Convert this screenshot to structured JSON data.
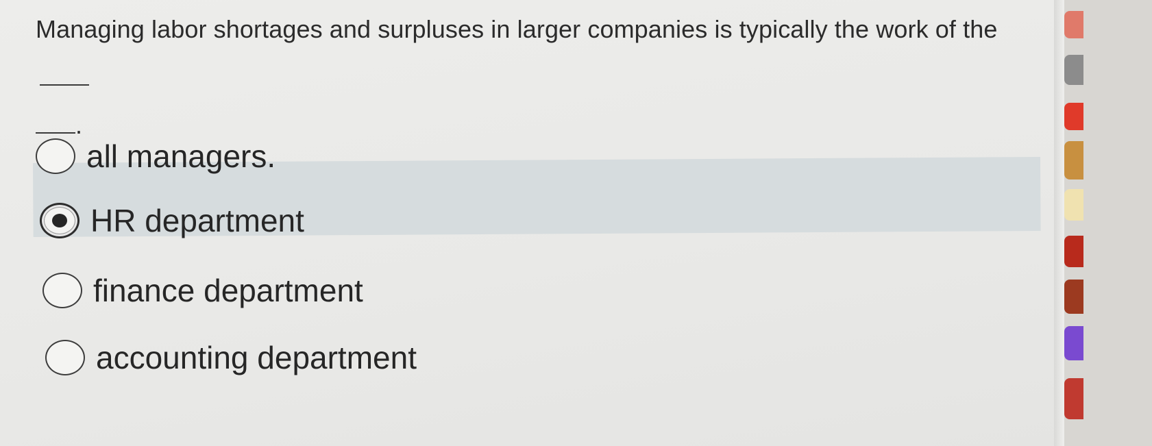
{
  "question": {
    "text": "Managing labor shortages and surpluses in larger companies is typically the work of the",
    "end_punctuation": "."
  },
  "options": [
    {
      "label": "all managers.",
      "selected": false
    },
    {
      "label": "HR department",
      "selected": true
    },
    {
      "label": "finance department",
      "selected": false
    },
    {
      "label": "accounting department",
      "selected": false
    }
  ],
  "colors": {
    "selected_highlight": "#d6dcde",
    "text": "#262626",
    "background": "#eaeae8"
  }
}
